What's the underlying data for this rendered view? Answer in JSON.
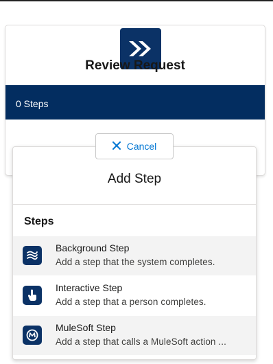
{
  "stage": {
    "icon": "chevrons-right-icon",
    "title": "Review Request",
    "steps_count_text": "0 Steps"
  },
  "cancel": {
    "icon": "close-icon",
    "label": "Cancel"
  },
  "add_step_panel": {
    "title": "Add Step",
    "section_label": "Steps",
    "items": [
      {
        "name": "Background Step",
        "description": "Add a step that the system completes.",
        "icon": "background-step-icon"
      },
      {
        "name": "Interactive Step",
        "description": "Add a step that a person completes.",
        "icon": "touch-hand-icon"
      },
      {
        "name": "MuleSoft Step",
        "description": "Add a step that calls a MuleSoft action ...",
        "icon": "mulesoft-icon"
      }
    ]
  },
  "colors": {
    "brand_navy": "#032d60",
    "link_blue": "#0176d3",
    "hover_row": "#f3f3f3"
  }
}
